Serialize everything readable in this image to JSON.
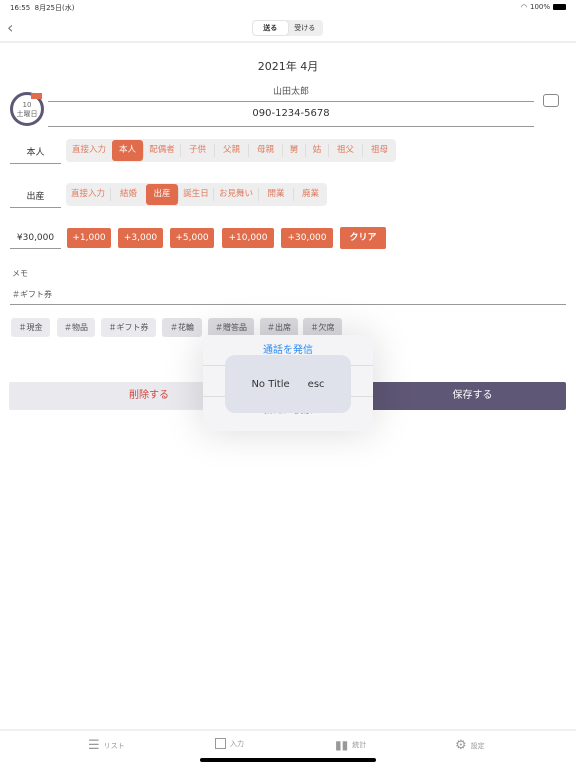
{
  "status": {
    "time": "16:55",
    "date": "8月25日(水)",
    "battery": "100%"
  },
  "nav": {
    "segments": [
      "送る",
      "受ける"
    ],
    "selected": 0
  },
  "title": "2021年 4月",
  "day": {
    "number": "10",
    "weekday": "土曜日"
  },
  "name": "山田太郎",
  "phone": "090-1234-5678",
  "relation": {
    "label": "本人",
    "options": [
      "直接入力",
      "本人",
      "配偶者",
      "子供",
      "父親",
      "母親",
      "舅",
      "姑",
      "祖父",
      "祖母"
    ],
    "selected": 1
  },
  "event": {
    "label": "出産",
    "options": [
      "直接入力",
      "結婚",
      "出産",
      "誕生日",
      "お見舞い",
      "開業",
      "廃業"
    ],
    "selected": 2
  },
  "amount": {
    "value": "¥30,000",
    "buttons": [
      "+1,000",
      "+3,000",
      "+5,000",
      "+10,000",
      "+30,000",
      "クリア"
    ]
  },
  "memo": {
    "label": "メモ",
    "value": "＃ギフト券"
  },
  "tags": [
    "＃現金",
    "＃物品",
    "＃ギフト券",
    "＃花輪",
    "＃贈答品",
    "＃出席",
    "＃欠席"
  ],
  "actions": {
    "delete": "削除する",
    "save": "保存する"
  },
  "popup": {
    "call": "通話を発信",
    "search": "新たに検索"
  },
  "hud": {
    "title": "No Title",
    "key": "esc"
  },
  "tabbar": [
    "リスト",
    "入力",
    "統計",
    "設定"
  ],
  "colors": {
    "accent": "#e06c4c",
    "save": "#5e5775",
    "link": "#2f8cf0",
    "delete": "#d0453a"
  }
}
